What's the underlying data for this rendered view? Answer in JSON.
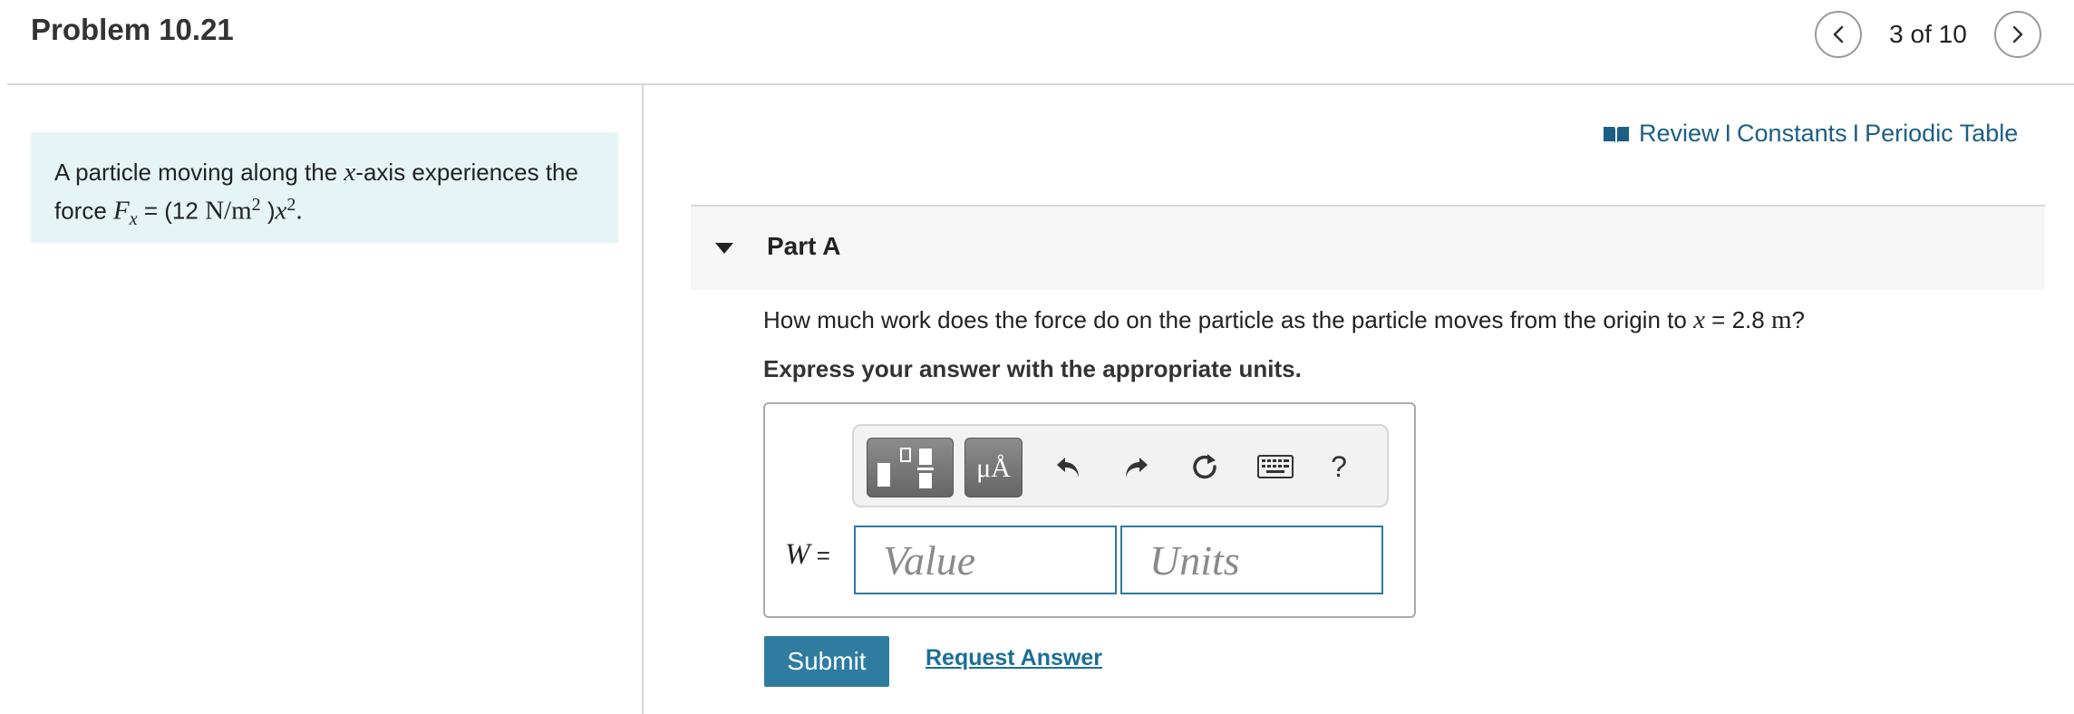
{
  "header": {
    "problem_title": "Problem 10.21",
    "page_counter": "3 of 10"
  },
  "problem": {
    "text_1": "A particle moving along the ",
    "var_x": "x",
    "text_2": "-axis experiences the",
    "text_3": "force ",
    "force_symbol": "F",
    "force_subscript": "x",
    "eq_start": " = (12 ",
    "unit_N": "N/m",
    "unit_exp": "2",
    "eq_paren": " )",
    "var_x2": "x",
    "var_exp": "2",
    "period": "."
  },
  "resources": {
    "review": "Review",
    "constants": "Constants",
    "periodic_table": "Periodic Table",
    "separator": "I"
  },
  "part": {
    "title": "Part A"
  },
  "question": {
    "text_1": "How much work does the force do on the particle as the particle moves from the origin to ",
    "var": "x",
    "text_2": " = 2.8 ",
    "unit": "m",
    "text_3": "?",
    "instruction": "Express your answer with the appropriate units."
  },
  "toolbar": {
    "units_symbol": "μÅ",
    "help": "?"
  },
  "answer": {
    "label_var": "W",
    "label_eq": " =",
    "value_placeholder": "Value",
    "units_placeholder": "Units"
  },
  "actions": {
    "submit": "Submit",
    "request_answer": "Request Answer"
  },
  "colors": {
    "accent": "#2e7ca0",
    "link": "#1b5f86",
    "problem_bg": "#e5f4f4"
  }
}
